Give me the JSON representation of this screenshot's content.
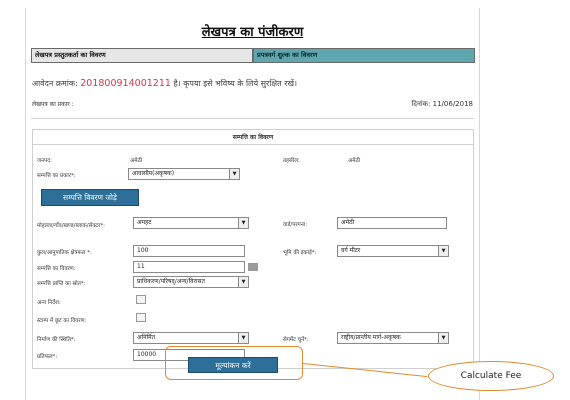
{
  "page_title": "लेखपत्र का पंजीकरण",
  "tabs": [
    {
      "label": "लेखपत्र प्रस्तुतकर्ता का विवरण"
    },
    {
      "label": "प्रपत्रवर्ग शुल्क का विवरण"
    }
  ],
  "application": {
    "prefix": "आवेदन क्रमांक: ",
    "number": "201800914001211",
    "suffix": " है। कृपया इसे भविष्य के लिये सुरक्षित रखें।"
  },
  "doc_type_label": "लेखपत्र का प्रकार :",
  "date_text": "दिनांक: 11/06/2018",
  "property": {
    "section_title": "सम्पत्ति का विवरण",
    "janpad_label": "जनपद:",
    "janpad_value": "अमेठी",
    "tehsil_label": "तहसील:",
    "tehsil_value": "अमेठी",
    "type_label": "सम्पत्ति का प्रकार*:",
    "type_value": "आवासीय(अकृषक)",
    "add_button": "सम्पत्ति विवरण जोड़े",
    "mohalla_label": "मोहल्ला/गाँव/खण्ड/ब्लाक/सेक्टर*:",
    "mohalla_value": "अमहट",
    "ward_label": "वार्ड/परगना:",
    "ward_value": "अमेठी",
    "area_label": "कुल/आनुपातिक क्षेत्रफल *:",
    "area_value": "100",
    "unit_label": "भूमि की इकाई*:",
    "unit_value": "वर्ग मीटर",
    "detail_label": "सम्पत्ति का विवरण:",
    "detail_value": "11",
    "source_label": "सम्पत्ति प्राप्ति का स्रोत*:",
    "source_value": "प्राधिकरण/परिषद्/अन्य/विरासत",
    "other_label": "अन्य निर्देश:",
    "stamp_label": "स्टाम्प में छूट का विवरण:",
    "construction_label": "निर्माण की स्थिति*:",
    "construction_value": "अनिर्मित",
    "road_label": "सेगमेंट चुनें*:",
    "road_value": "राष्ट्रीय/प्रान्तीय मार्ग-अकृषक",
    "consideration_label": "प्रतिफल*:",
    "consideration_value": "10000"
  },
  "evaluate_button": "मूल्यांकन करें",
  "callout_text": "Calculate Fee",
  "colors": {
    "tab_accent": "#5fa7ae",
    "button_blue": "#2d6f98",
    "app_number": "#d8344a",
    "callout": "#e08a30"
  },
  "icons": [
    "dropdown-arrow-icon"
  ]
}
